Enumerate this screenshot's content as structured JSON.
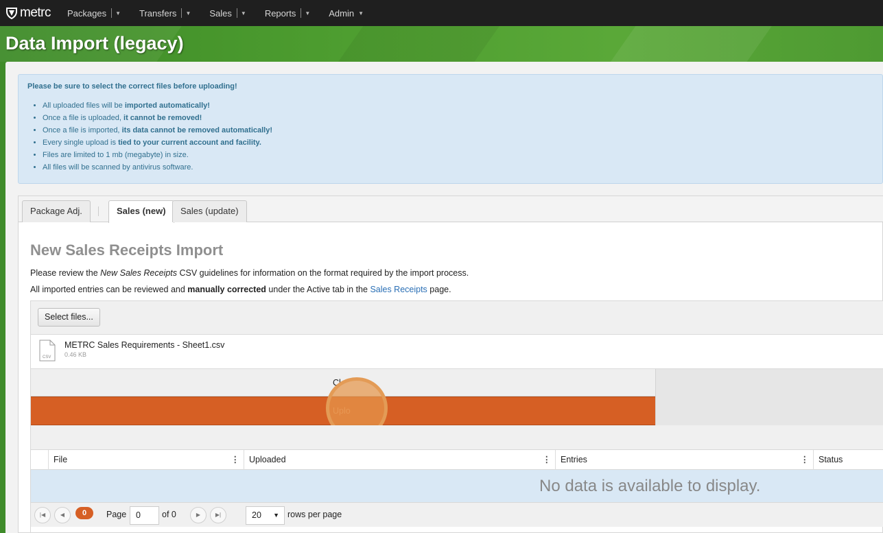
{
  "nav": {
    "brand": "metrc",
    "items": [
      {
        "label": "Packages"
      },
      {
        "label": "Transfers"
      },
      {
        "label": "Sales"
      },
      {
        "label": "Reports"
      },
      {
        "label": "Admin"
      }
    ]
  },
  "header": {
    "title": "Data Import (legacy)"
  },
  "alert": {
    "title": "Please be sure to select the correct files before uploading!",
    "items": [
      {
        "pre": "All uploaded files will be ",
        "bold": "imported automatically!"
      },
      {
        "pre": "Once a file is uploaded, ",
        "bold": "it cannot be removed!"
      },
      {
        "pre": "Once a file is imported, ",
        "bold": "its data cannot be removed automatically!"
      },
      {
        "pre": "Every single upload is ",
        "bold": "tied to your current account and facility."
      },
      {
        "pre": "Files are limited to 1 mb (megabyte) in size.",
        "bold": ""
      },
      {
        "pre": "All files will be scanned by antivirus software.",
        "bold": ""
      }
    ]
  },
  "tabs": [
    {
      "label": "Package Adj."
    },
    {
      "label": "Sales (new)"
    },
    {
      "label": "Sales (update)"
    }
  ],
  "section": {
    "title": "New Sales Receipts Import",
    "p1_pre": "Please review the ",
    "p1_italic": "New Sales Receipts",
    "p1_post": " CSV guidelines for information on the format required by the import process.",
    "p2_pre": "All imported entries can be reviewed and ",
    "p2_bold": "manually corrected",
    "p2_mid": " under the Active tab in the ",
    "p2_link": "Sales Receipts",
    "p2_post": " page."
  },
  "upload": {
    "select_label": "Select files...",
    "file_name": "METRC Sales Requirements - Sheet1.csv",
    "file_size": "0.46 KB",
    "file_ext": "CSV",
    "clear_label": "Cl",
    "upload_label": "Uplo"
  },
  "grid": {
    "columns": [
      "File",
      "Uploaded",
      "Entries",
      "Status"
    ],
    "empty_text": "No data is available to display."
  },
  "pager": {
    "count_badge": "0",
    "page_label": "Page",
    "page_value": "0",
    "of_label": "of 0",
    "page_size": "20",
    "rows_label": "rows per page"
  },
  "colors": {
    "accent_orange": "#d65f24",
    "header_green": "#4e9e30",
    "info_blue": "#d9e8f5",
    "link_blue": "#2a6fb5"
  }
}
